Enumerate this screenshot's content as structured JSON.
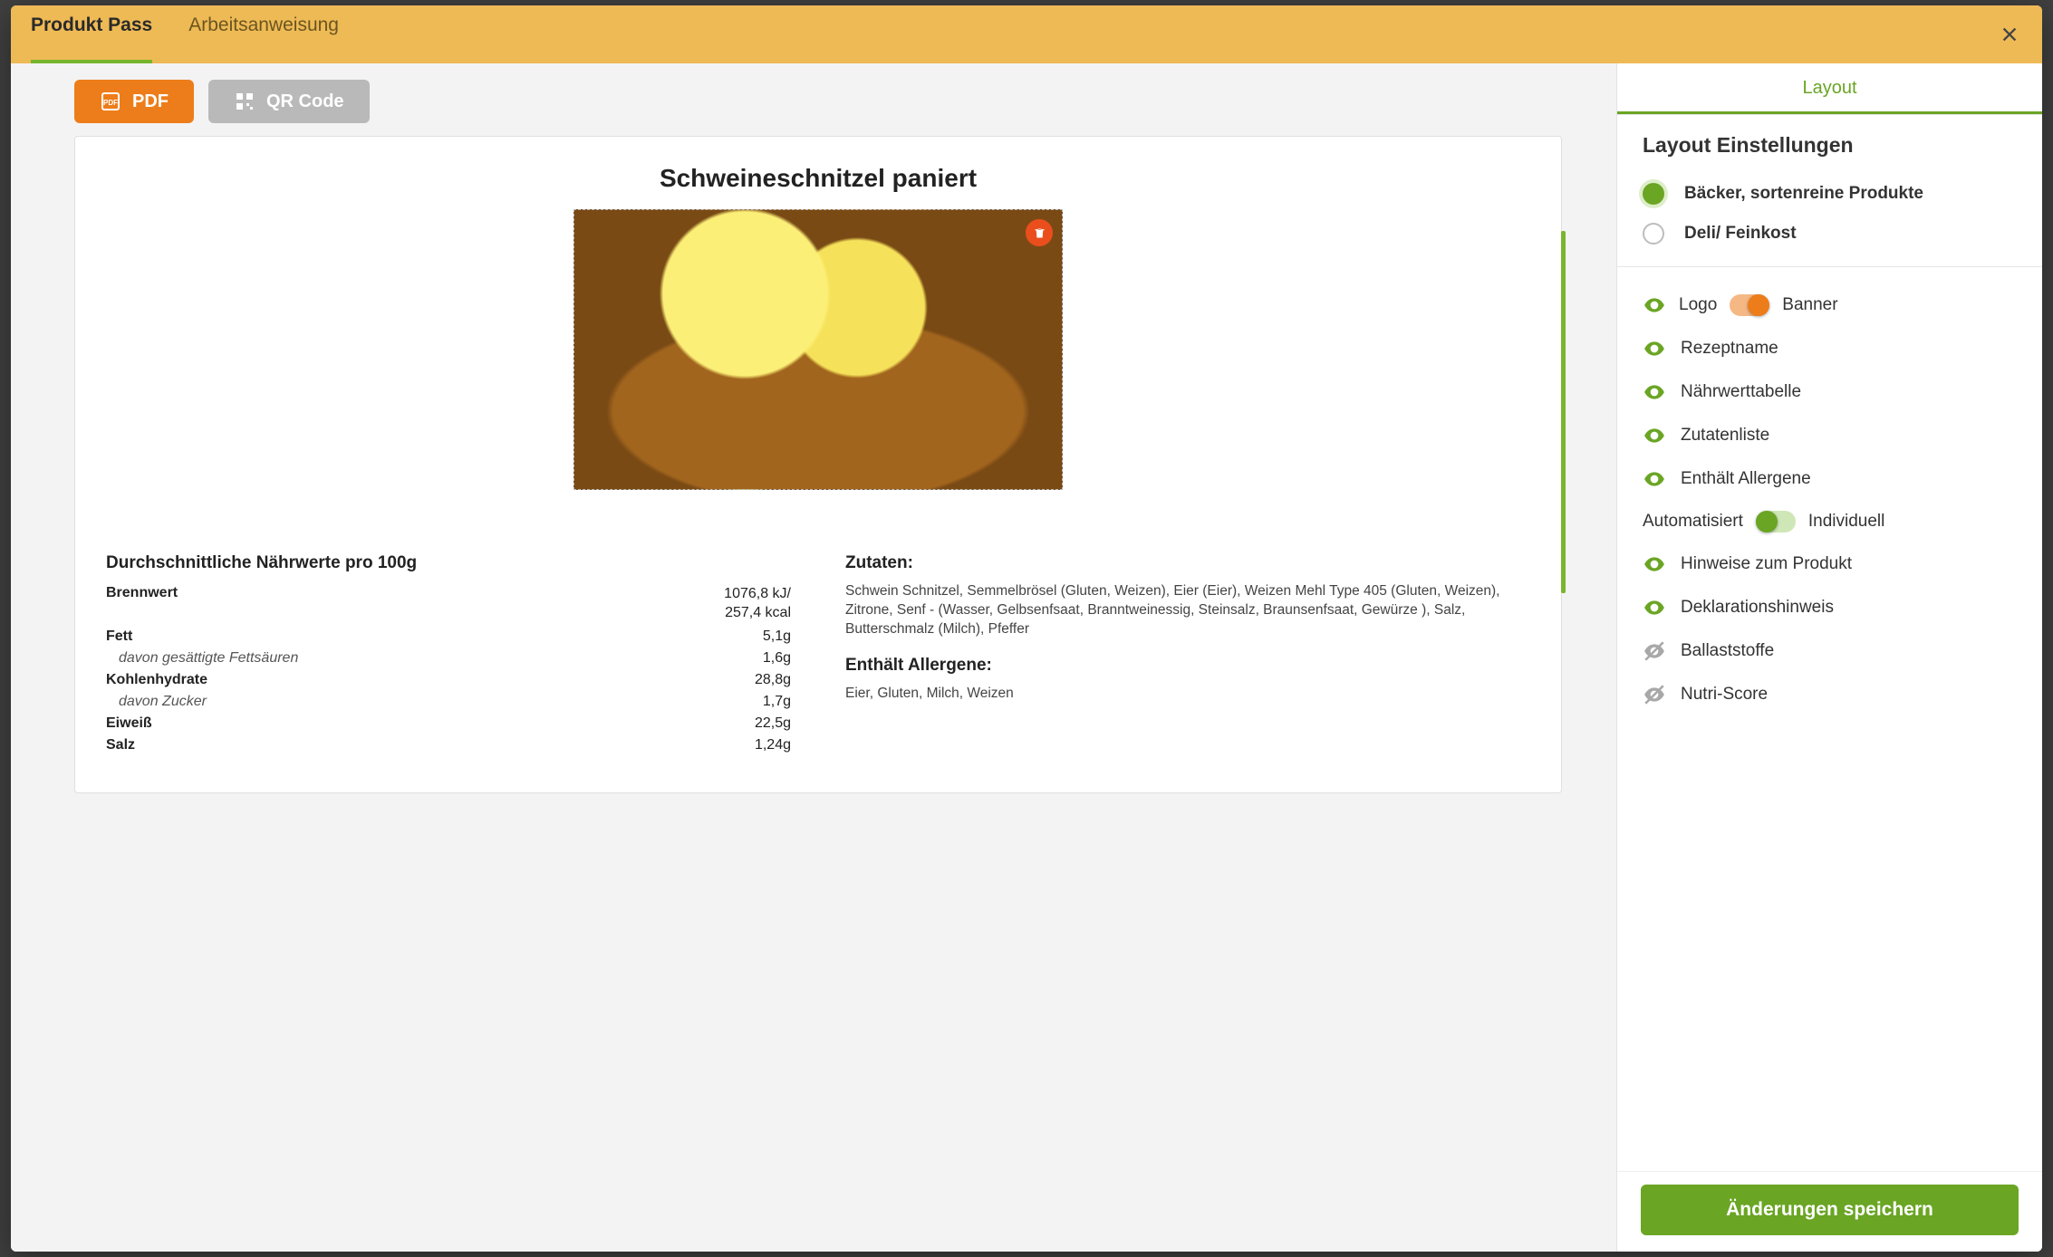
{
  "tabs": {
    "product_pass": "Produkt Pass",
    "work_instruction": "Arbeitsanweisung"
  },
  "buttons": {
    "pdf": "PDF",
    "qr": "QR Code",
    "save": "Änderungen speichern"
  },
  "product": {
    "title": "Schweineschnitzel paniert",
    "nutrition_heading": "Durchschnittliche Nährwerte pro 100g",
    "nutrition": [
      {
        "k": "Brennwert",
        "v": "1076,8 kJ/\n257,4 kcal",
        "sub": false
      },
      {
        "k": "Fett",
        "v": "5,1g",
        "sub": false
      },
      {
        "k": "davon gesättigte Fettsäuren",
        "v": "1,6g",
        "sub": true
      },
      {
        "k": "Kohlenhydrate",
        "v": "28,8g",
        "sub": false
      },
      {
        "k": "davon Zucker",
        "v": "1,7g",
        "sub": true
      },
      {
        "k": "Eiweiß",
        "v": "22,5g",
        "sub": false
      },
      {
        "k": "Salz",
        "v": "1,24g",
        "sub": false
      }
    ],
    "ingredients_heading": "Zutaten:",
    "ingredients": "Schwein Schnitzel, Semmelbrösel (Gluten, Weizen), Eier (Eier), Weizen Mehl Type 405 (Gluten, Weizen), Zitrone, Senf - (Wasser, Gelbsenfsaat, Branntweinessig, Steinsalz, Braunsenfsaat, Gewürze ), Salz, Butterschmalz (Milch), Pfeffer",
    "allergens_heading": "Enthält Allergene:",
    "allergens": "Eier, Gluten, Milch, Weizen"
  },
  "layout": {
    "tab": "Layout",
    "heading": "Layout Einstellungen",
    "presets": {
      "baker": "Bäcker, sortenreine Produkte",
      "deli": "Deli/ Feinkost"
    },
    "logo_row": {
      "left": "Logo",
      "right": "Banner"
    },
    "auto_row": {
      "left": "Automatisiert",
      "right": "Individuell"
    },
    "toggles": {
      "recipe_name": "Rezeptname",
      "nutrition_table": "Nährwerttabelle",
      "ingredient_list": "Zutatenliste",
      "allergens": "Enthält Allergene",
      "product_hints": "Hinweise zum Produkt",
      "declaration": "Deklarationshinweis",
      "fiber": "Ballaststoffe",
      "nutriscore": "Nutri-Score"
    }
  }
}
